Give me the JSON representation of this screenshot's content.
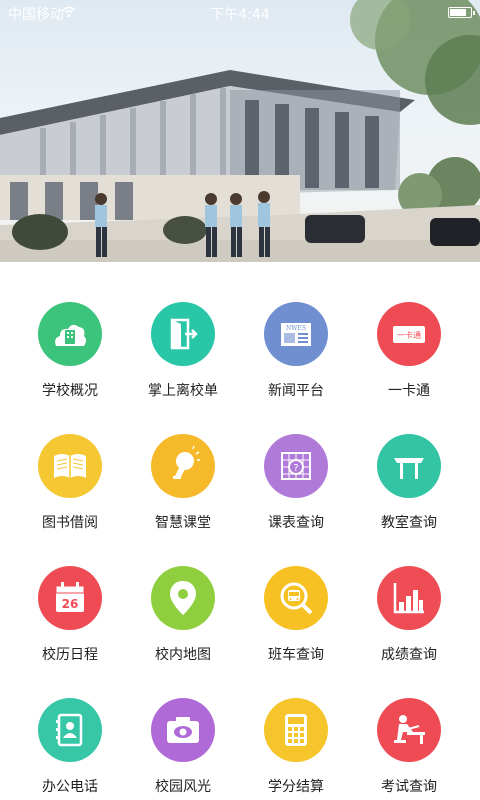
{
  "status_bar": {
    "carrier": "中国移动",
    "time": "下午4:44"
  },
  "hero": {
    "image": "campus-building-photo"
  },
  "menu": [
    {
      "label": "学校概况",
      "icon": "school-building-icon",
      "color": "#3cc47c"
    },
    {
      "label": "掌上离校单",
      "icon": "door-exit-icon",
      "color": "#29c6a8"
    },
    {
      "label": "新闻平台",
      "icon": "newspaper-icon",
      "color": "#6f8fd1",
      "badge": "NWES"
    },
    {
      "label": "一卡通",
      "icon": "card-icon",
      "color": "#ef4b55",
      "badge": "一卡通"
    },
    {
      "label": "图书借阅",
      "icon": "book-icon",
      "color": "#f4c733"
    },
    {
      "label": "智慧课堂",
      "icon": "lightbulb-icon",
      "color": "#f6b92a"
    },
    {
      "label": "课表查询",
      "icon": "schedule-icon",
      "color": "#b07ad9"
    },
    {
      "label": "教室查询",
      "icon": "desk-icon",
      "color": "#33c5a3"
    },
    {
      "label": "校历日程",
      "icon": "calendar-icon",
      "color": "#ef4b55",
      "badge": "26"
    },
    {
      "label": "校内地图",
      "icon": "map-pin-icon",
      "color": "#8fcf3f"
    },
    {
      "label": "班车查询",
      "icon": "bus-search-icon",
      "color": "#f7c124"
    },
    {
      "label": "成绩查询",
      "icon": "bar-chart-icon",
      "color": "#ee4d55"
    },
    {
      "label": "办公电话",
      "icon": "phonebook-icon",
      "color": "#37c7a7"
    },
    {
      "label": "校园风光",
      "icon": "camera-icon",
      "color": "#b06ad8"
    },
    {
      "label": "学分结算",
      "icon": "calculator-icon",
      "color": "#f5c52b"
    },
    {
      "label": "考试查询",
      "icon": "exam-icon",
      "color": "#ef4b55"
    }
  ]
}
